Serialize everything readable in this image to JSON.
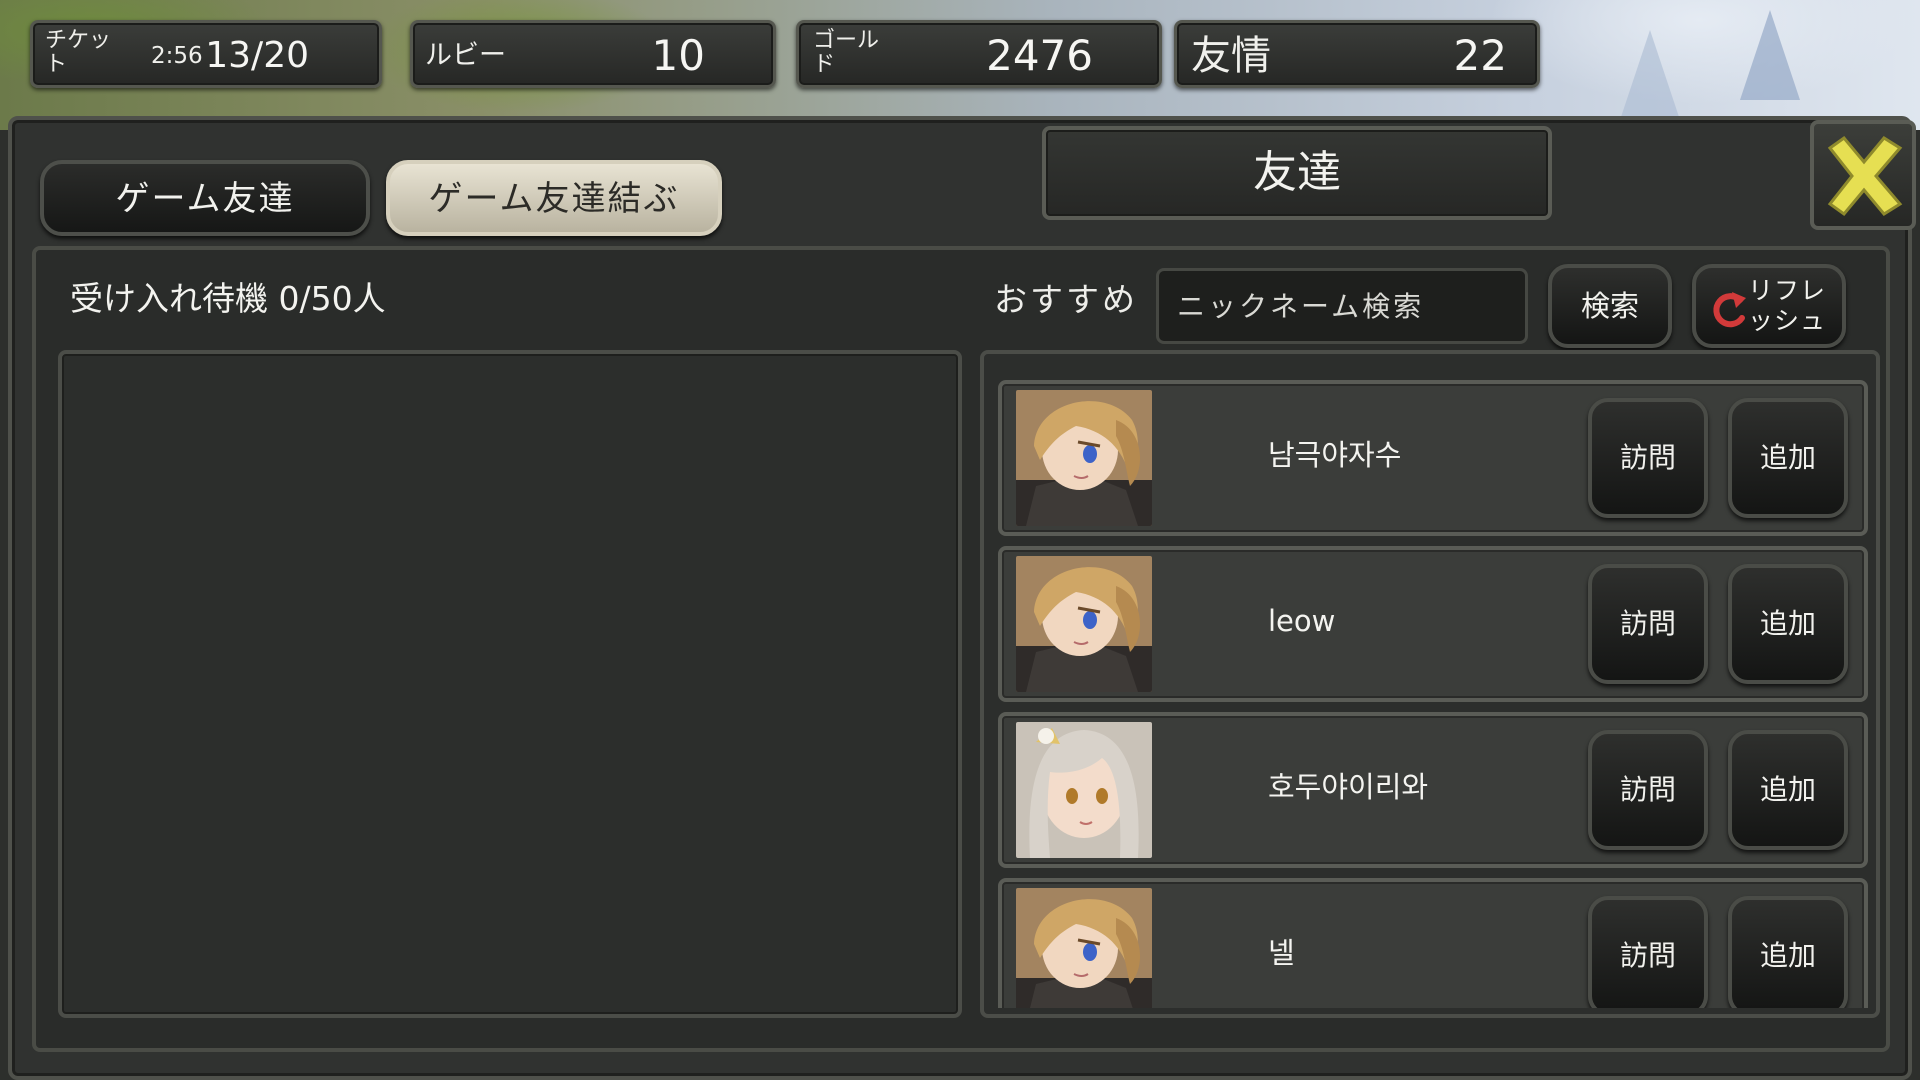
{
  "resources": {
    "ticket": {
      "label": "チケット",
      "timer": "2:56",
      "value": "13/20"
    },
    "ruby": {
      "label": "ルビー",
      "value": "10"
    },
    "gold": {
      "label": "ゴールド",
      "value": "2476"
    },
    "friendship": {
      "label": "友情",
      "value": "22"
    }
  },
  "tabs": {
    "game_friends": "ゲーム友達",
    "add_friends": "ゲーム友達結ぶ",
    "active": "add_friends"
  },
  "panel": {
    "title": "友達",
    "close_icon": "close-x-icon"
  },
  "pending": {
    "label": "受け入れ待機 0/50人"
  },
  "recommend": {
    "label": "おすすめ",
    "search_placeholder": "ニックネーム検索",
    "search_button": "検索",
    "refresh_button": "リフレッシュ",
    "refresh_icon": "refresh-icon"
  },
  "players": [
    {
      "name": "남극야자수",
      "portrait": "blonde-knight",
      "visit": "訪問",
      "add": "追加"
    },
    {
      "name": "leow",
      "portrait": "blonde-knight",
      "visit": "訪問",
      "add": "追加"
    },
    {
      "name": "호두야이리와",
      "portrait": "silver-haired-girl",
      "visit": "訪問",
      "add": "追加"
    },
    {
      "name": "넬",
      "portrait": "blonde-knight",
      "visit": "訪問",
      "add": "追加"
    }
  ],
  "colors": {
    "close_x": "#e6df52",
    "refresh_icon": "#d23a3a",
    "active_tab": "#d9d3bf"
  }
}
